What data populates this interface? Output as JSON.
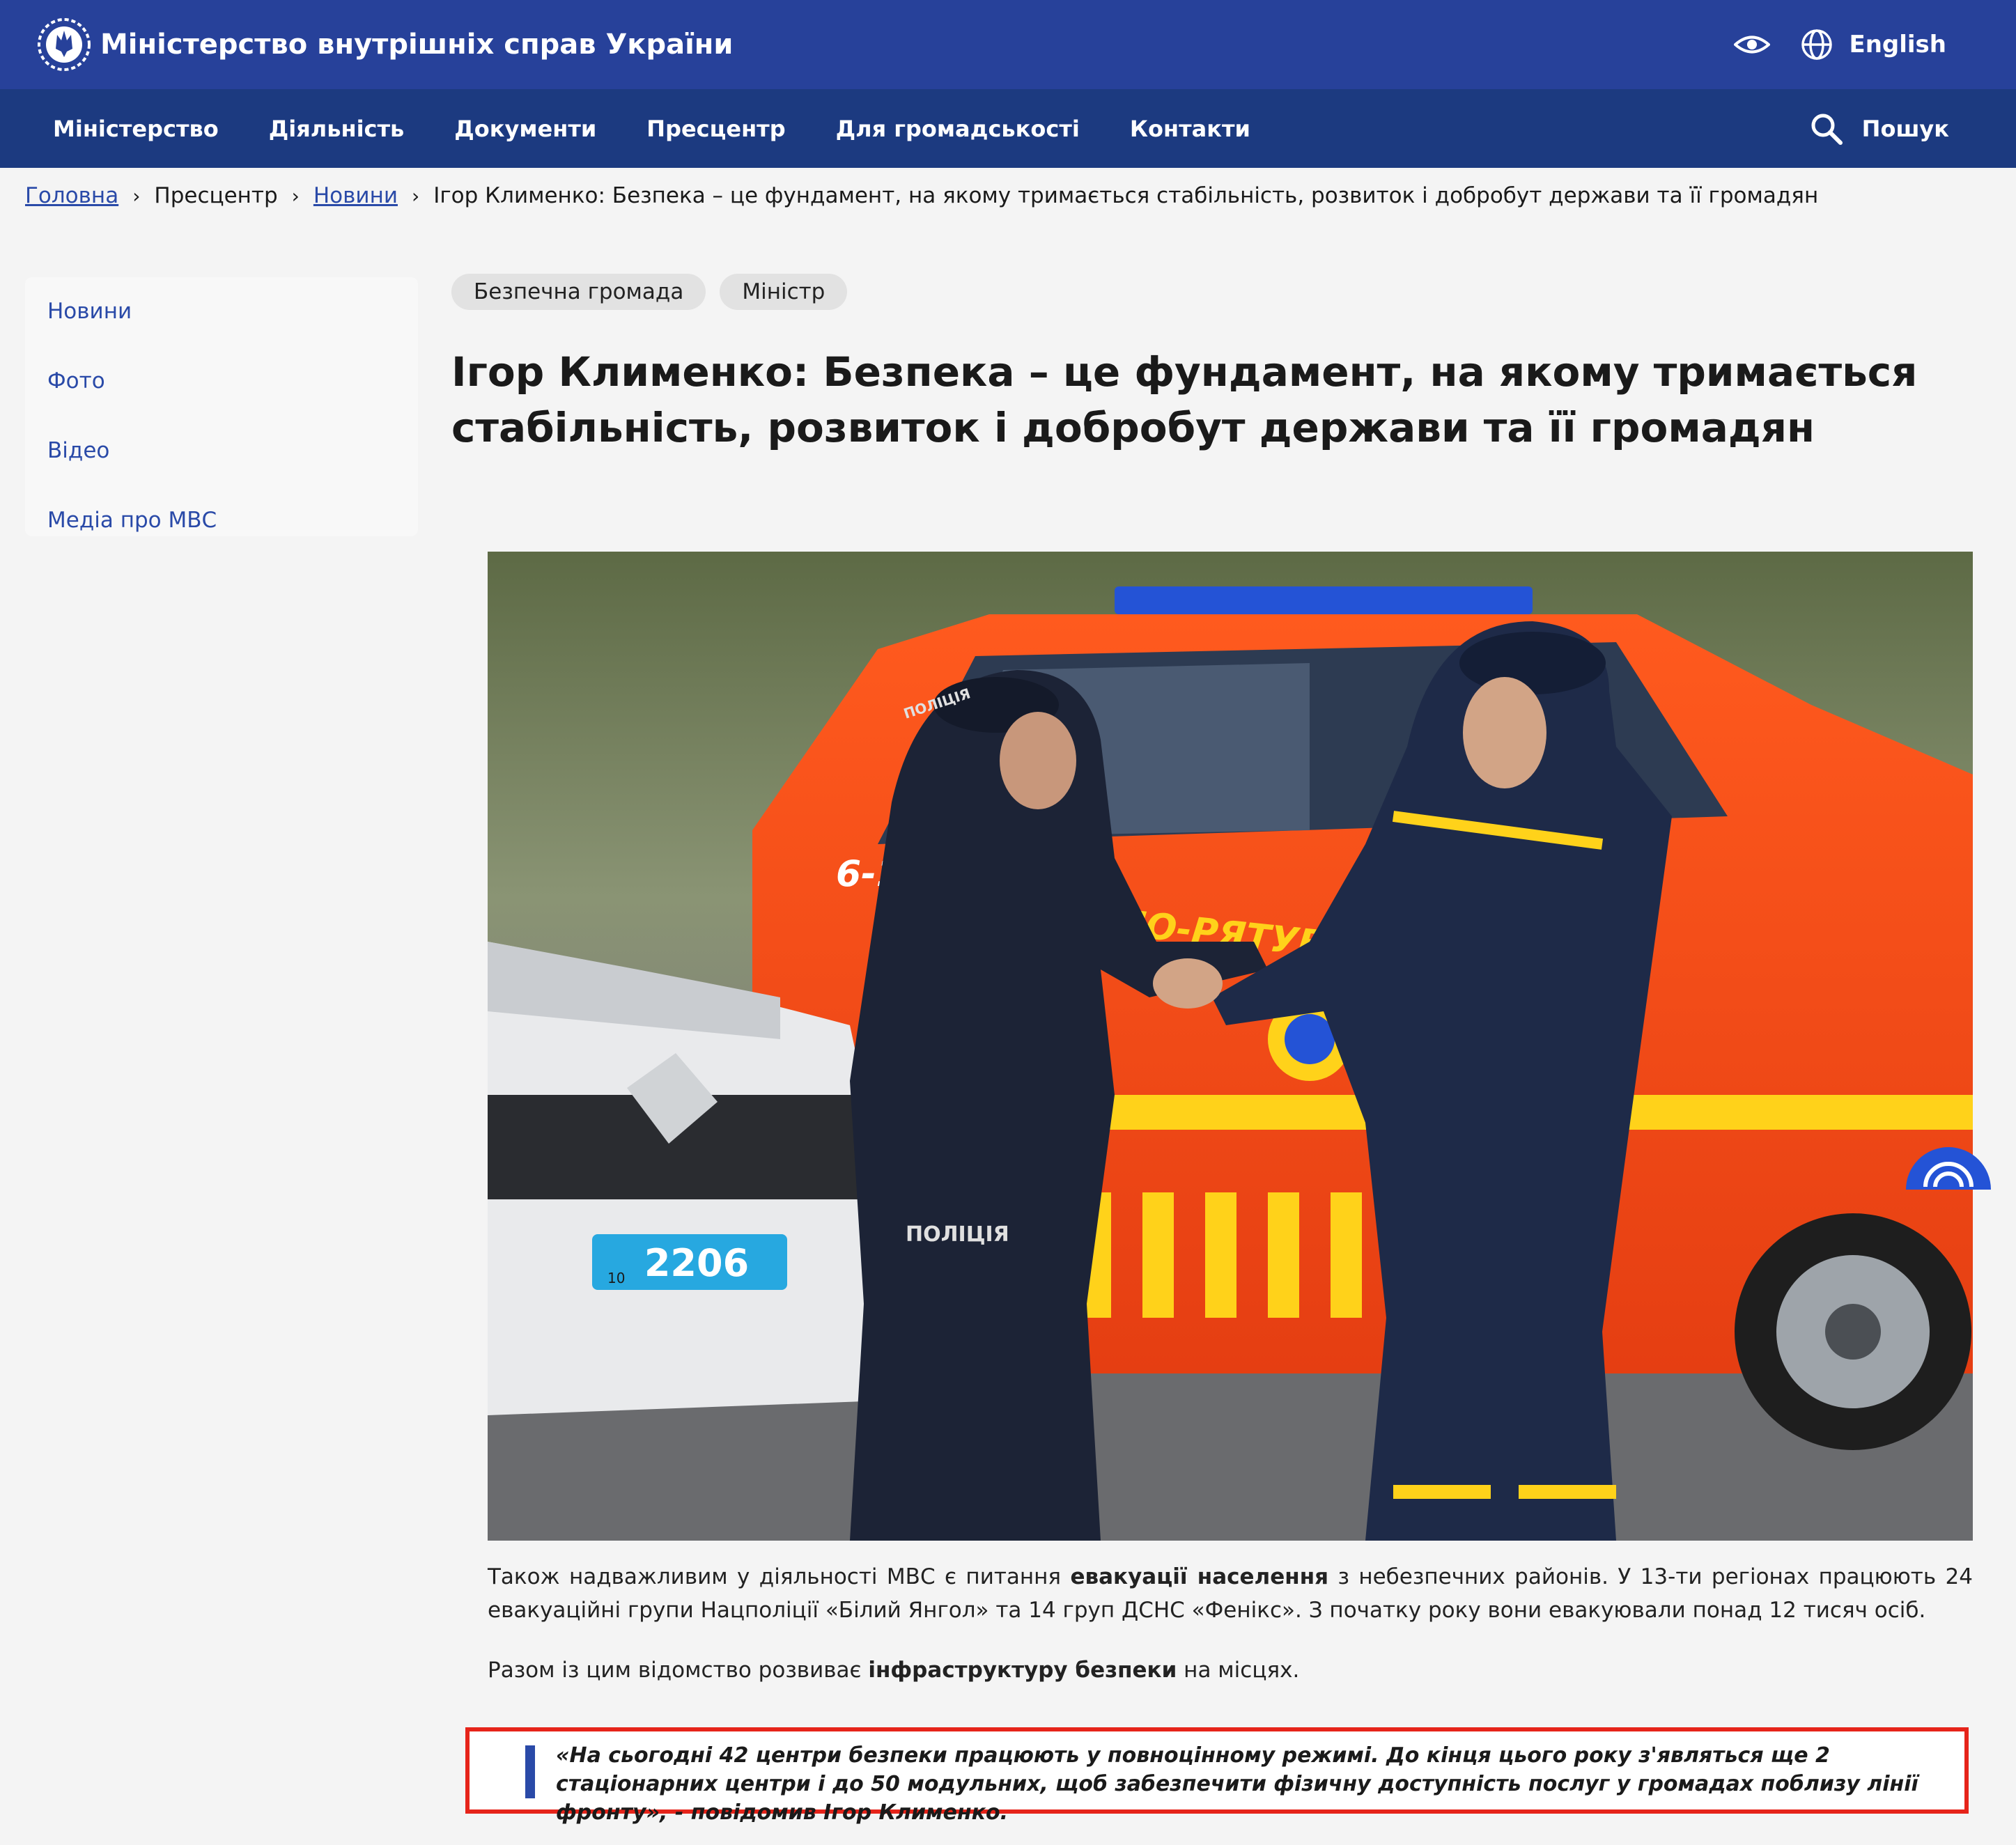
{
  "header": {
    "title": "Міністерство внутрішніх справ України",
    "language_label": "English",
    "emblem_icon": "trident-emblem-icon",
    "accent_color": "#27419a"
  },
  "nav": {
    "items": [
      "Міністерство",
      "Діяльність",
      "Документи",
      "Пресцентр",
      "Для громадськості",
      "Контакти"
    ],
    "search_label": "Пошук"
  },
  "breadcrumb": {
    "home": "Головна",
    "press": "Пресцентр",
    "news": "Новини",
    "current": "Ігор Клименко: Безпека – це фундамент, на якому тримається стабільність, розвиток і добробут держави та її громадян"
  },
  "sidebar": {
    "items": [
      "Новини",
      "Фото",
      "Відео",
      "Медіа про МВС"
    ]
  },
  "article": {
    "tags": [
      "Безпечна громада",
      "Міністр"
    ],
    "headline": "Ігор Клименко: Безпека – це фундамент, на якому тримається стабільність, розвиток і добробут держави та її громадян",
    "photo": {
      "car_number": "2206",
      "plate_region": "10",
      "truck_code": "6-101",
      "truck_text": "НО-РЯТУВАЛЬН",
      "cap_text": "ПОЛІЦІЯ",
      "back_text": "ПОЛІЦІЯ"
    },
    "p1": {
      "t1": "Також надважливим у діяльності МВС є питання ",
      "b1": "евакуації населення",
      "t2": " з небезпечних районів. У 13-ти регіонах працюють 24 евакуаційні групи Нацполіції «Білий Янгол» та 14 груп ДСНС «Фенікс». З початку року вони евакуювали понад 12 тисяч осіб."
    },
    "p2": {
      "t1": "Разом із цим відомство розвиває ",
      "b1": "інфраструктуру безпеки",
      "t2": " на місцях."
    },
    "quote": "«На сьогодні 42 центри безпеки працюють у повноцінному режимі. До кінця цього року з'являться ще 2 стаціонарних центри і до 50 модульних, щоб забезпечити фізичну доступність послуг у громадах поблизу лінії фронту», - повідомив Ігор Клименко."
  }
}
